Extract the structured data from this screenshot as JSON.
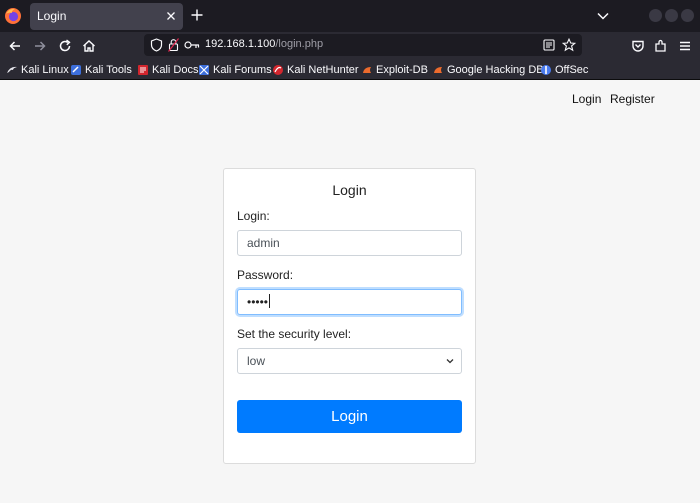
{
  "browser": {
    "tab_title": "Login",
    "url_host": "192.168.1.100",
    "url_path": "/login.php",
    "bookmarks": [
      {
        "label": "Kali Linux",
        "icon": "kali-dragon-icon"
      },
      {
        "label": "Kali Tools",
        "icon": "kali-tools-icon"
      },
      {
        "label": "Kali Docs",
        "icon": "kali-docs-icon"
      },
      {
        "label": "Kali Forums",
        "icon": "kali-forums-icon"
      },
      {
        "label": "Kali NetHunter",
        "icon": "kali-nethunter-icon"
      },
      {
        "label": "Exploit-DB",
        "icon": "exploit-db-icon"
      },
      {
        "label": "Google Hacking DB",
        "icon": "ghdb-icon"
      },
      {
        "label": "OffSec",
        "icon": "offsec-icon"
      }
    ]
  },
  "page": {
    "nav_login": "Login",
    "nav_register": "Register",
    "card_title": "Login",
    "login_label": "Login:",
    "login_value": "admin",
    "password_label": "Password:",
    "password_value": "•••••",
    "security_label": "Set the security level:",
    "security_value": "low",
    "submit_label": "Login"
  },
  "colors": {
    "accent": "#007bff",
    "tabbar_bg": "#1c1b22",
    "toolbar_bg": "#2b2a33"
  }
}
